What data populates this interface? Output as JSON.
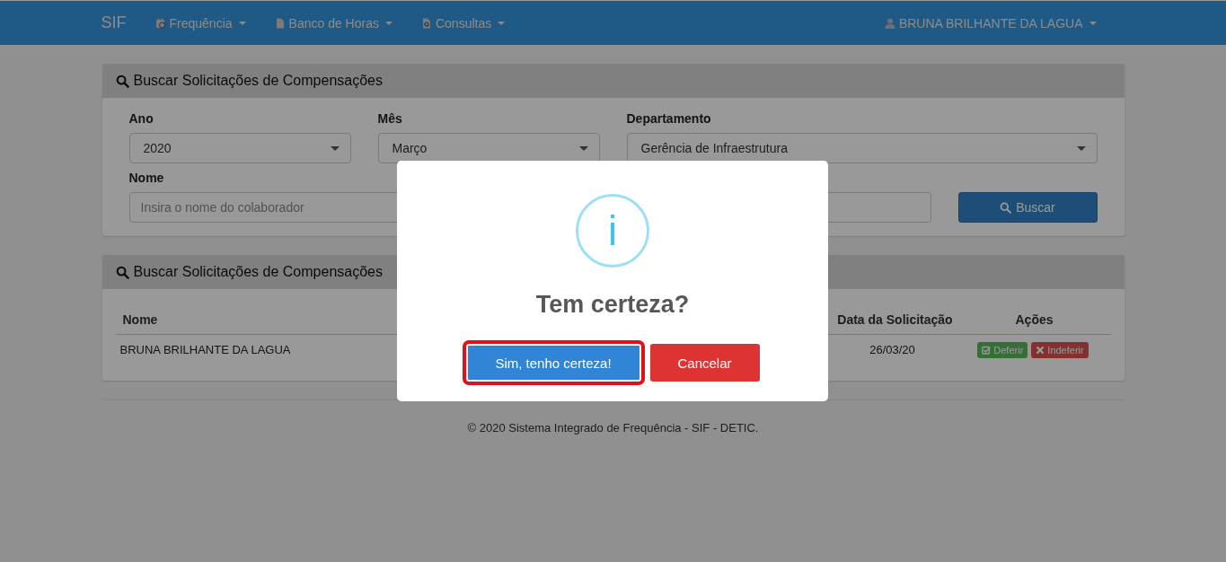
{
  "navbar": {
    "brand": "SIF",
    "menus": [
      {
        "label": "Frequência"
      },
      {
        "label": "Banco de Horas"
      },
      {
        "label": "Consultas"
      }
    ],
    "user": "BRUNA BRILHANTE DA LAGUA"
  },
  "search_panel": {
    "title": "Buscar Solicitações de Compensações",
    "fields": [
      {
        "label": "Ano",
        "value": "2020"
      },
      {
        "label": "Mês",
        "value": "Março"
      },
      {
        "label": "Departamento",
        "value": "Gerência de Infraestrutura"
      }
    ],
    "name_field": {
      "label": "Nome",
      "placeholder": "Insira o nome do colaborador"
    },
    "button": "Buscar"
  },
  "results_panel": {
    "title": "Buscar Solicitações de Compensações",
    "columns": [
      "Nome",
      "Data da Solicitação",
      "Ações"
    ],
    "rows": [
      {
        "name": "BRUNA BRILHANTE DA LAGUA",
        "date": "26/03/20",
        "actions": [
          {
            "kind": "approve",
            "label": "Deferir"
          },
          {
            "kind": "reject",
            "label": "Indeferir"
          }
        ]
      }
    ]
  },
  "footer": "© 2020 Sistema Integrado de Frequência - SIF - DETIC.",
  "dialog": {
    "icon": "i",
    "title": "Tem certeza?",
    "confirm": {
      "label": "Sim, tenho certeza!",
      "focused": true
    },
    "cancel": "Cancelar"
  }
}
